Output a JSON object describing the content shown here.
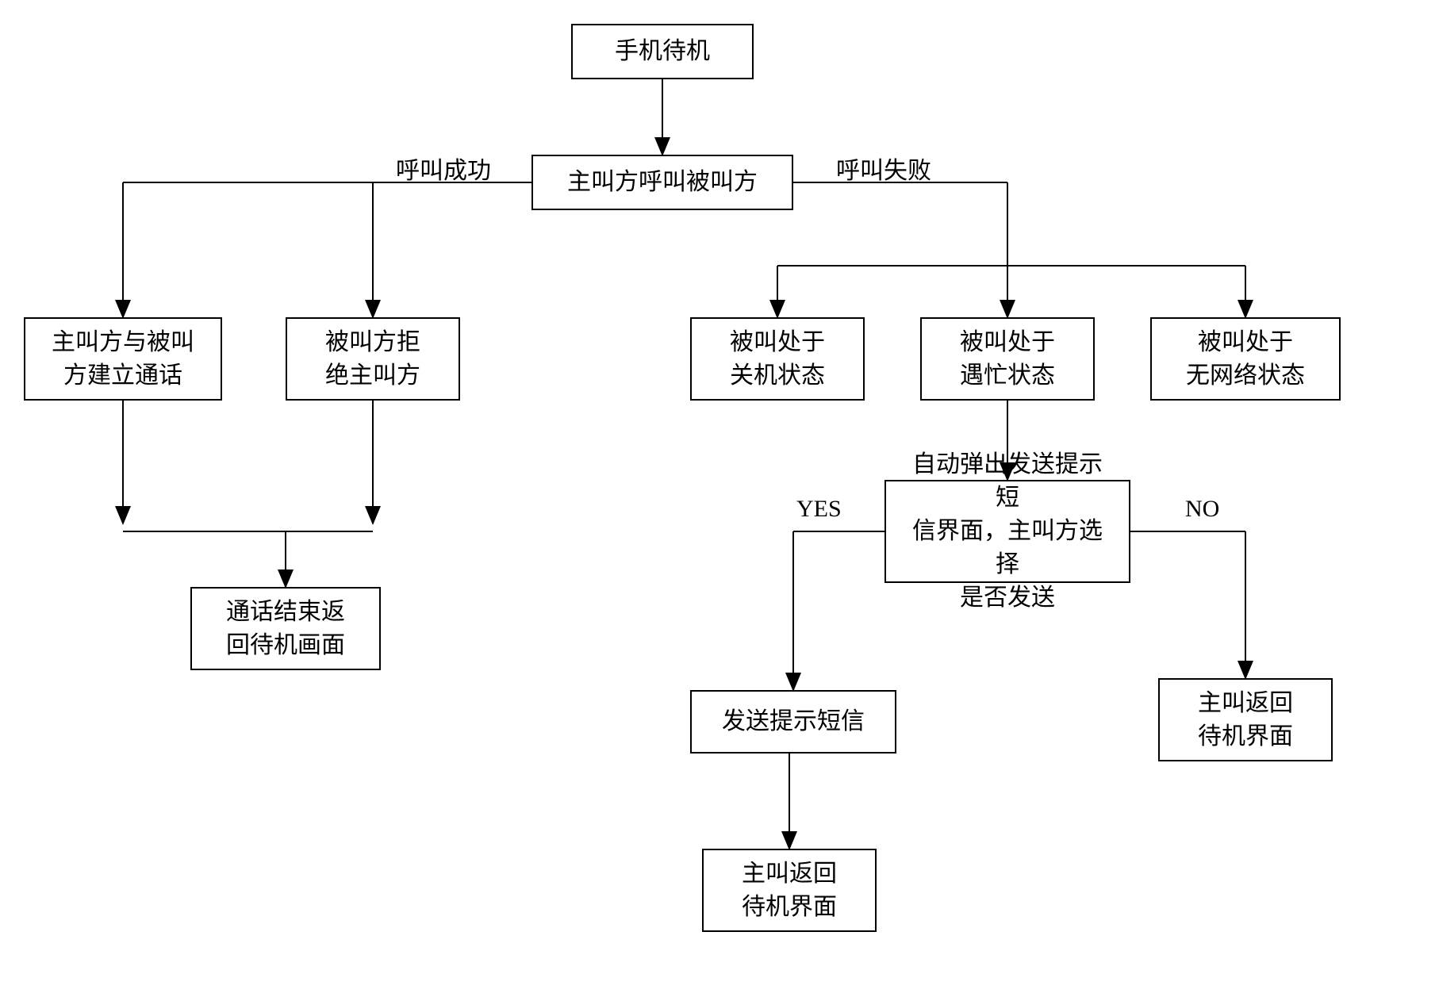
{
  "nodes": {
    "standby": "手机待机",
    "caller_calls": "主叫方呼叫被叫方",
    "call_success": "呼叫成功",
    "call_fail": "呼叫失败",
    "establish": "主叫方与被叫\n方建立通话",
    "reject": "被叫方拒\n绝主叫方",
    "poweroff": "被叫处于\n关机状态",
    "busy": "被叫处于\n遇忙状态",
    "nonet": "被叫处于\n无网络状态",
    "end_return": "通话结束返\n回待机画面",
    "popup": "自动弹出发送提示短\n信界面，主叫方选择\n是否发送",
    "yes": "YES",
    "no": "NO",
    "send_sms": "发送提示短信",
    "return1": "主叫返回\n待机界面",
    "return2": "主叫返回\n待机界面"
  }
}
